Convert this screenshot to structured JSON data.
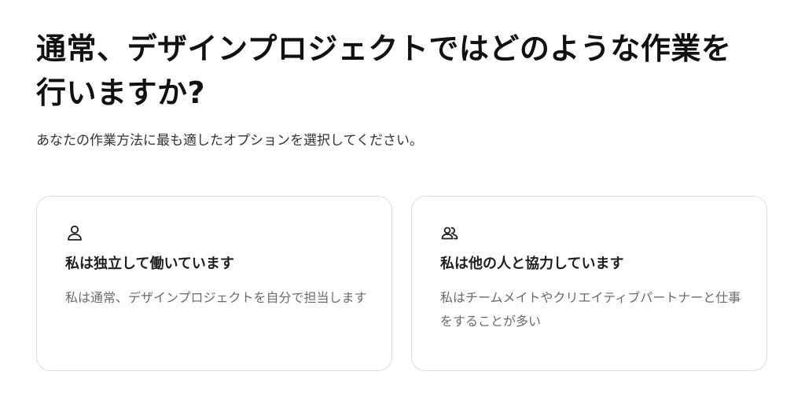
{
  "question": {
    "title": "通常、デザインプロジェクトではどのような作業を行いますか?",
    "subtitle": "あなたの作業方法に最も適したオプションを選択してください。"
  },
  "options": [
    {
      "icon": "person-icon",
      "title": "私は独立して働いています",
      "description": "私は通常、デザインプロジェクトを自分で担当します"
    },
    {
      "icon": "people-icon",
      "title": "私は他の人と協力しています",
      "description": "私はチームメイトやクリエイティブパートナーと仕事をすることが多い"
    }
  ]
}
